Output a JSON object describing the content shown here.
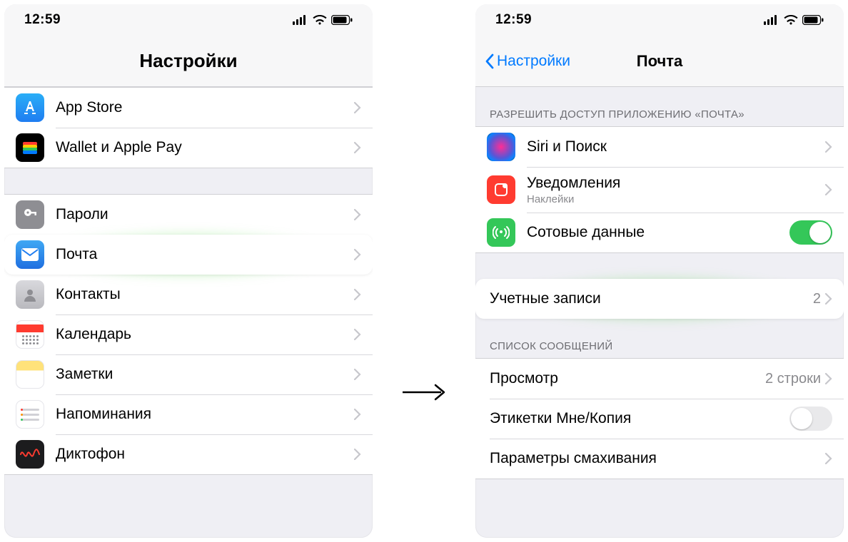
{
  "status": {
    "time": "12:59"
  },
  "left": {
    "title": "Настройки",
    "group1": [
      {
        "key": "appstore",
        "label": "App Store"
      },
      {
        "key": "wallet",
        "label": "Wallet и Apple Pay"
      }
    ],
    "group2": [
      {
        "key": "passwords",
        "label": "Пароли"
      },
      {
        "key": "mail",
        "label": "Почта",
        "highlight": true
      },
      {
        "key": "contacts",
        "label": "Контакты"
      },
      {
        "key": "calendar",
        "label": "Календарь"
      },
      {
        "key": "notes",
        "label": "Заметки"
      },
      {
        "key": "reminders",
        "label": "Напоминания"
      },
      {
        "key": "voice",
        "label": "Диктофон"
      }
    ]
  },
  "right": {
    "back": "Настройки",
    "title": "Почта",
    "section_allow": "РАЗРЕШИТЬ ДОСТУП ПРИЛОЖЕНИЮ «ПОЧТА»",
    "allow": {
      "siri": {
        "label": "Siri и Поиск"
      },
      "notif": {
        "label": "Уведомления",
        "sub": "Наклейки"
      },
      "cell": {
        "label": "Сотовые данные",
        "toggle": true
      }
    },
    "accounts": {
      "label": "Учетные записи",
      "value": "2"
    },
    "section_list": "СПИСОК СООБЩЕНИЙ",
    "listrows": {
      "preview": {
        "label": "Просмотр",
        "value": "2 строки"
      },
      "labels": {
        "label": "Этикетки Мне/Копия",
        "toggle": false
      },
      "swipe": {
        "label": "Параметры смахивания"
      }
    }
  }
}
